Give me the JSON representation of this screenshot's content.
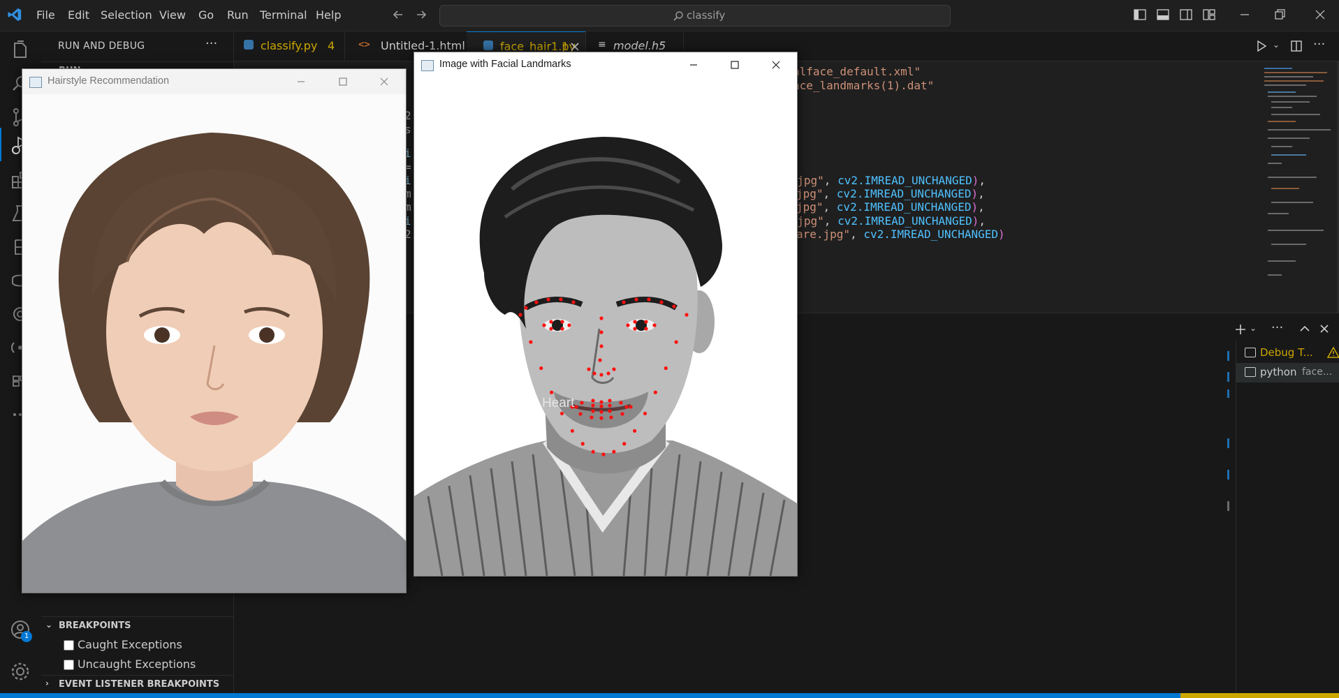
{
  "titlebar": {
    "menu": [
      "File",
      "Edit",
      "Selection",
      "View",
      "Go",
      "Run",
      "Terminal",
      "Help"
    ],
    "search_text": "classify"
  },
  "sidebar": {
    "header": "RUN AND DEBUG",
    "run_section": "RUN",
    "breakpoints_header": "BREAKPOINTS",
    "caught_exceptions": "Caught Exceptions",
    "uncaught_exceptions": "Uncaught Exceptions",
    "event_listener_header": "EVENT LISTENER BREAKPOINTS",
    "account_badge": "1"
  },
  "tabs": [
    {
      "label": "classify.py",
      "badge": "4",
      "color": "#cca700"
    },
    {
      "label": "Untitled-1.html",
      "color": "#cccccc"
    },
    {
      "label": "face_hair1.py",
      "badge": "1",
      "color": "#cca700"
    },
    {
      "label": "model.h5",
      "color": "#cccccc"
    }
  ],
  "code_lines": [
    {
      "a": "alface_default.xml\"",
      "b": ""
    },
    {
      "a": "ace_landmarks(1).dat\"",
      "b": ""
    },
    {
      "a": "t.jpg\"",
      "b": "cv2.IMREAD_UNCHANGED"
    },
    {
      "a": "jpg\"",
      "b": "cv2.IMREAD_UNCHANGED"
    },
    {
      "a": "jpg\"",
      "b": "cv2.IMREAD_UNCHANGED"
    },
    {
      "a": "d.jpg\"",
      "b": "cv2.IMREAD_UNCHANGED"
    },
    {
      "a": "are.jpg\"",
      "b": "cv2.IMREAD_UNCHANGED"
    }
  ],
  "terminal_list": [
    {
      "label": "Debug T...",
      "color": "#cca700"
    },
    {
      "label": "python",
      "suffix": "face...",
      "color": "#cccccc"
    }
  ],
  "window_hairstyle": {
    "title": "Hairstyle Recommendation"
  },
  "window_landmarks": {
    "title": "Image with Facial Landmarks",
    "face_shape_label": "Heart"
  }
}
